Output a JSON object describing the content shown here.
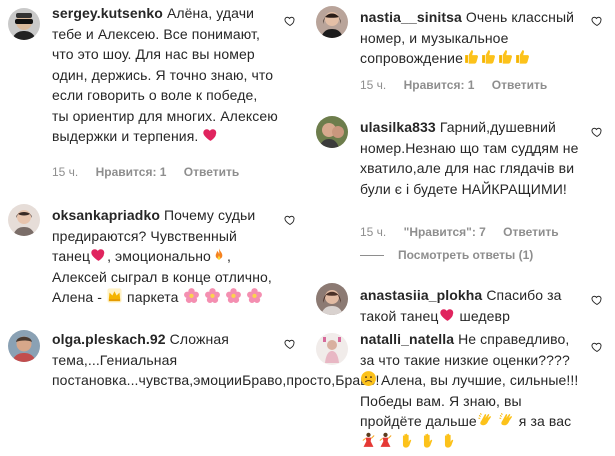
{
  "comments_left": [
    {
      "username": "sergey.kutsenko",
      "text": "Алёна, удачи тебе и Алексею. Все понимают, что это шоу. Для нас вы номер один, держись. Я точно знаю, что если говорить о воле к победе, ты ориентир для многих. Алексею выдержки и терпения.",
      "time": "15 ч.",
      "likes": "Нравится: 1",
      "reply": "Ответить"
    },
    {
      "username": "oksankapriadko",
      "text_parts": [
        "Почему судьи предираются? Чувственный танец",
        ", эмоционально",
        ", Алексей сыграл в конце отлично, Алена - ",
        " паркета "
      ]
    },
    {
      "username": "olga.pleskach.92",
      "text": "Сложная тема,...Гениальная постановка...чувства,эмоцииБраво,просто,Браво!"
    }
  ],
  "comments_right": [
    {
      "username": "nastia__sinitsa",
      "text": "Очень классный номер, и музыкальное сопровождение",
      "time": "15 ч.",
      "likes": "Нравится: 1",
      "reply": "Ответить"
    },
    {
      "username": "ulasilka833",
      "text": "Гарний,душевний номер.Незнаю що там суддям не хватило,але для нас глядачів ви були є і будете НАЙКРАЩИМИ!",
      "time": "15 ч.",
      "likes": "\"Нравится\": 7",
      "reply": "Ответить",
      "view_replies": "Посмотреть ответы (1)"
    },
    {
      "username": "anastasiia_plokha",
      "text_parts": [
        "Спасибо за такой танец",
        " шедевр"
      ]
    },
    {
      "username": "natalli_natella",
      "text_parts": [
        "Не справедливо, за что такие низкие оценки????",
        " Алена, вы лучшие, сильные!!! Победы вам. Я знаю, вы пройдёте дальше",
        " я за вас"
      ]
    }
  ],
  "icons": {
    "like": "heart-outline-icon",
    "red_heart": "red-heart-emoji",
    "fire": "fire-emoji",
    "crown": "crown-emoji",
    "flower": "pink-flower-emoji",
    "thumbs_up": "thumbs-up-emoji",
    "sad": "sad-face-emoji",
    "clap": "clapping-hands-emoji",
    "dancer": "dancer-emoji",
    "wave": "raised-hand-emoji"
  },
  "colors": {
    "text": "#262626",
    "meta": "#8e8e8e",
    "heart_red": "#ed4956"
  }
}
